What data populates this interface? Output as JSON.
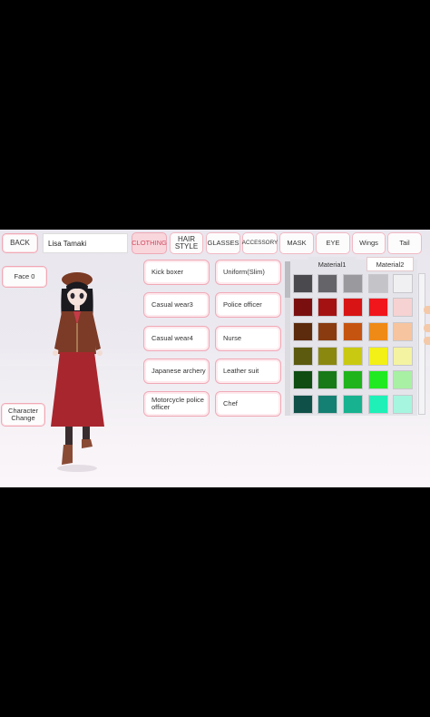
{
  "topbar": {
    "back_label": "BACK",
    "name_value": "Lisa Tamaki",
    "tabs": [
      {
        "label": "CLOTHING",
        "active": true
      },
      {
        "label": "HAIR\nSTYLE",
        "active": false
      },
      {
        "label": "GLASSES",
        "active": false
      },
      {
        "label": "ACCESSORY",
        "active": false
      },
      {
        "label": "MASK",
        "active": false
      },
      {
        "label": "EYE",
        "active": false
      },
      {
        "label": "Wings",
        "active": false
      },
      {
        "label": "Tail",
        "active": false
      }
    ]
  },
  "left": {
    "face_label": "Face 0",
    "character_change_label": "Character\nChange"
  },
  "clothing": {
    "items": [
      "Kick boxer",
      "Uniform(Slim)",
      "Casual wear3",
      "Police officer",
      "Casual wear4",
      "Nurse",
      "Japanese archery",
      "Leather suit",
      "Motorcycle police\nofficer",
      "Chef"
    ]
  },
  "materials": {
    "tabs": [
      "Material1",
      "Material2"
    ],
    "active_tab": "Material2"
  },
  "palette": {
    "rows": [
      [
        "#4a4a4e",
        "#656569",
        "#9a9a9e",
        "#c4c4c8",
        "#f0f0f2",
        "#f2f2f4"
      ],
      [
        "#7a0f0f",
        "#a51212",
        "#d81414",
        "#f0161c",
        "#f6d2d2",
        "#f6d2d2"
      ],
      [
        "#5c2a0c",
        "#8a3b10",
        "#c65411",
        "#ef8a16",
        "#f6c49e",
        "#f6c49e"
      ],
      [
        "#5b5a0f",
        "#8a880f",
        "#c9c912",
        "#f2f016",
        "#f4f3a2",
        "#f4f3a2"
      ],
      [
        "#0f4d12",
        "#177a17",
        "#1fb31c",
        "#22ea22",
        "#a8f0a4",
        "#a8f0a4"
      ],
      [
        "#0f5048",
        "#138073",
        "#17b28f",
        "#1ff0b8",
        "#a6f5de",
        "#a6f5de"
      ]
    ]
  }
}
